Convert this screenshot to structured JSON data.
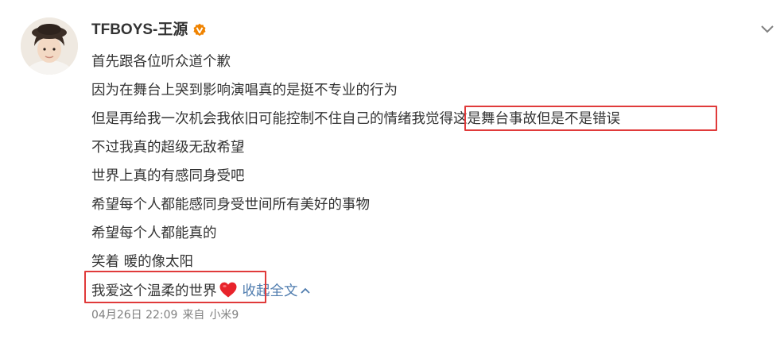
{
  "author": {
    "name": "TFBOYS-王源",
    "verified_badge": "verified-icon"
  },
  "post": {
    "lines": [
      "首先跟各位听众道个歉",
      "因为在舞台上哭到影响演唱真的是挺不专业的行为",
      "但是再给我一次机会我依旧可能控制不住自己的情绪",
      "不过我真的超级无敌希望",
      "世界上真的有感同身受吧",
      "希望每个人都能感同身受世间所有美好的事物",
      "希望每个人都能真的",
      "笑着 暖的像太阳",
      "我爱这个温柔的世界"
    ],
    "line3_highlight": "我觉得这是舞台事故但是不是错误",
    "collapse_label": "收起全文"
  },
  "meta": {
    "date": "04月26日 22:09",
    "source_prefix": "来自",
    "device": "小米9"
  },
  "colors": {
    "link": "#507daf",
    "highlight_border": "#e03a3a",
    "verified": "#f08300",
    "heart": "#e8232b"
  }
}
